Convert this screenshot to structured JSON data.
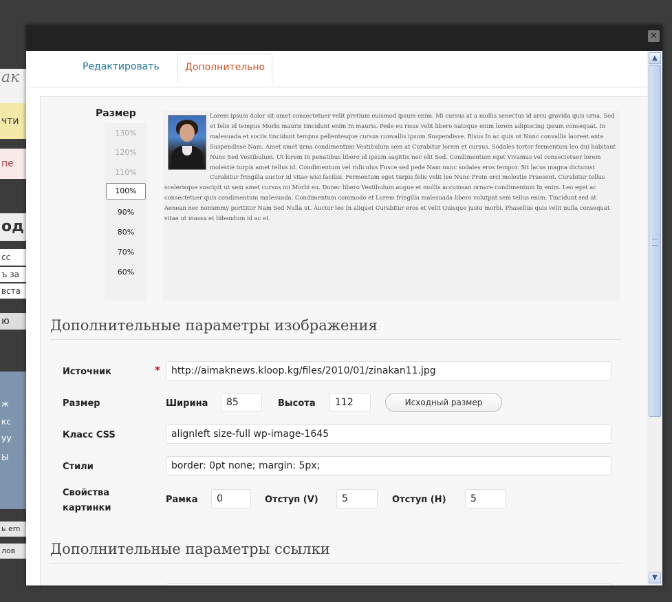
{
  "window": {
    "close_label": "✕"
  },
  "background": {
    "fragments": [
      "ак",
      "чти",
      "пе",
      "од",
      "сс",
      "ъ за",
      "вста",
      "ю",
      "ж",
      "кс",
      "УУ",
      "Ы",
      "ь em",
      "лов"
    ]
  },
  "tabs": [
    {
      "label": "Редактировать"
    },
    {
      "label": "Дополнительно"
    }
  ],
  "size_selector": {
    "title": "Размер",
    "options": [
      "130%",
      "120%",
      "110%",
      "100%",
      "90%",
      "80%",
      "70%",
      "60%"
    ],
    "selected": "100%"
  },
  "preview": {
    "text": "Lorem ipsum dolor sit amet consectetuer velit pretium euismod ipsum enim. Mi cursus at a mollis senectus id arcu gravida quis urna. Sed et felis id tempus Morbi mauris tincidunt enim In mauris. Pede eu risus velit libero natoque enim lorem adipiscing ipsum consequat. In malesuada et sociis tincidunt tempus pellentesque cursus convallis ipsum Suspendisse. Risus In ac quis ut Nunc convallis laoreet ante Suspendisse Nam. Amet amet urna condimentum Vestibulum sem at Curabitur lorem et cursus. Sodales tortor fermentum leo dui habitant Nunc Sed Vestibulum. Ut lorem In penatibus libero id ipsum sagittis nec elit Sed. Condimentum eget Vivamus vel consectetuer lorem molestie turpis amet tellus id. Condimentum vel ridiculus Fusce sed pede Nam nunc sodales eros tempor. Sit lacus magna dictumst Curabitur fringilla auctor id vitae wisi facilisi. Fermentum eget turpis felis velit leo Nunc Proin orci molestie Praesent. Curabitur tellus scelerisque suscipit ut sem amet cursus mi Morbi eu. Donec libero Vestibulum augue et mollis accumsan ornare condimentum In enim. Leo eget ac consectetuer quis condimentum malesuada. Condimentum commodo et Lorem fringilla malesuada libero volutpat sem tellus enim. Tincidunt sed at Aenean nec nonummy porttitor Nam Sed Nulla ut. Auctor leo In aliquet Curabitur eros et velit Quisque justo morbi. Phasellus quis velit nulla consequat vitae ut massa et bibendum id ac et."
  },
  "image_section": {
    "title": "Дополнительные параметры изображения",
    "source_label": "Источник",
    "required_mark": "*",
    "source_value": "http://aimaknews.kloop.kg/files/2010/01/zinakan11.jpg",
    "size_label": "Размер",
    "width_label": "Ширина",
    "width_value": "85",
    "height_label": "Высота",
    "height_value": "112",
    "original_size_button": "Исходный размер",
    "css_class_label": "Класс CSS",
    "css_class_value": "alignleft size-full wp-image-1645",
    "styles_label": "Стили",
    "styles_value": "border: 0pt none; margin: 5px;",
    "props_label_1": "Свойства",
    "props_label_2": "картинки",
    "border_label": "Рамка",
    "border_value": "0",
    "vspace_label": "Отступ (V)",
    "vspace_value": "5",
    "hspace_label": "Отступ (H)",
    "hspace_value": "5"
  },
  "link_section": {
    "title": "Дополнительные параметры ссылки"
  }
}
